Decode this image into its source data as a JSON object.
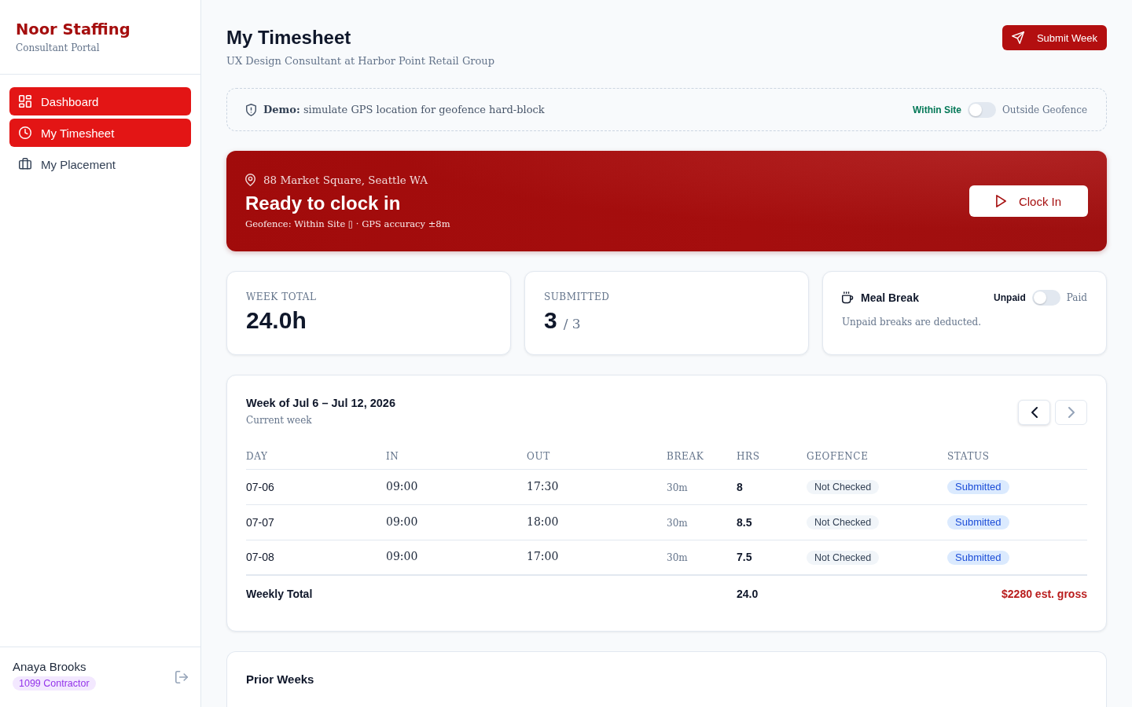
{
  "sidebar": {
    "brand": "Noor Staffing",
    "tagline": "Consultant Portal",
    "items": [
      {
        "label": "Dashboard",
        "selected": true
      },
      {
        "label": "My Timesheet",
        "selected": true
      },
      {
        "label": "My Placement",
        "selected": false
      }
    ],
    "user": {
      "name": "Anaya Brooks",
      "badge": "1099 Contractor"
    }
  },
  "header": {
    "title": "My Timesheet",
    "subtitle": "UX Design Consultant at Harbor Point Retail Group",
    "submit_button": "Submit Week"
  },
  "demo_bar": {
    "text": "**Demo:** simulate GPS location for geofence hard-block",
    "off_label": "Within Site",
    "on_label": "Outside Geofence",
    "on": false
  },
  "clock_panel": {
    "location": "88 Market Square, Seattle WA",
    "status": "Ready to clock in",
    "detail": "Geofence: Within Site ▯ · GPS accuracy ±8m",
    "button": "Clock In"
  },
  "stats": [
    {
      "label": "WEEK TOTAL",
      "value": "24.0h"
    },
    {
      "label": "SUBMITTED",
      "value": "3",
      "of": "/ 3"
    }
  ],
  "meal_break": {
    "title": "Meal Break",
    "off_label": "Unpaid",
    "on_label": "Paid",
    "on": false,
    "note": "Unpaid breaks are deducted."
  },
  "week": {
    "title": "Week of Jul 6 – Jul 12, 2026",
    "subtitle": "Current week",
    "nav": [
      {
        "disabled": false
      },
      {
        "disabled": true
      }
    ],
    "table": {
      "columns": [
        "DAY",
        "IN",
        "OUT",
        "BREAK",
        "HRS",
        "GEOFENCE",
        "STATUS"
      ],
      "rows": [
        {
          "day": "07-06",
          "in": "09:00",
          "out": "17:30",
          "break": "30m",
          "hrs": "8",
          "geofence": "Not Checked",
          "status": "Submitted"
        },
        {
          "day": "07-07",
          "in": "09:00",
          "out": "18:00",
          "break": "30m",
          "hrs": "8.5",
          "geofence": "Not Checked",
          "status": "Submitted"
        },
        {
          "day": "07-08",
          "in": "09:00",
          "out": "17:00",
          "break": "30m",
          "hrs": "7.5",
          "geofence": "Not Checked",
          "status": "Submitted"
        }
      ],
      "total": {
        "label": "Weekly Total",
        "hrs": "24.0",
        "gross": "$2280 est. gross"
      }
    }
  },
  "prior_weeks": {
    "title": "Prior Weeks"
  }
}
